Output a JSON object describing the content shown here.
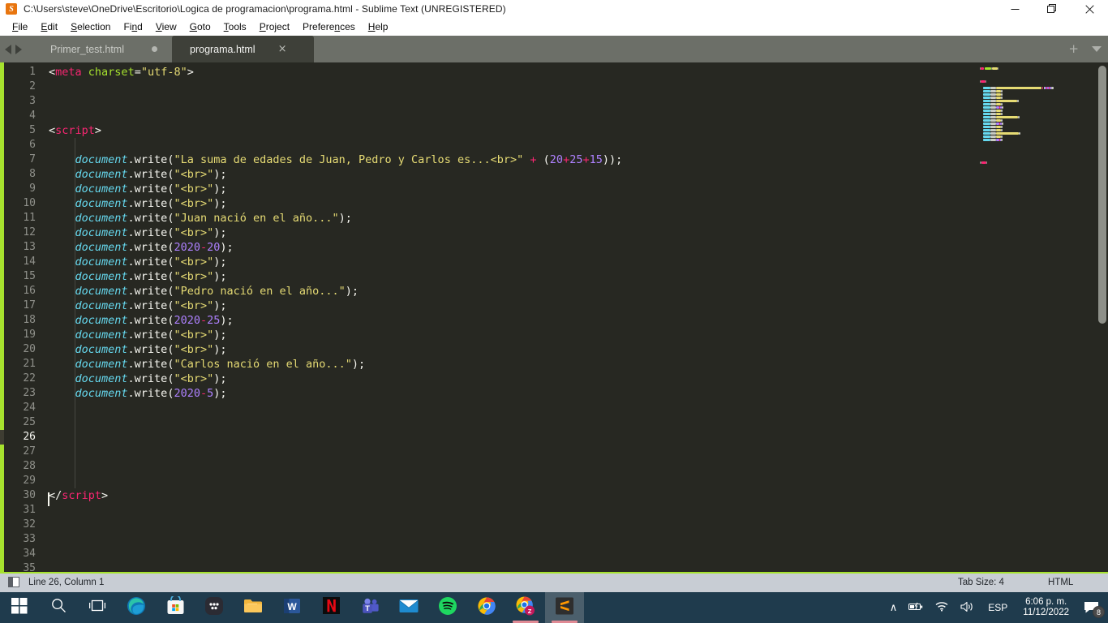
{
  "window": {
    "title": "C:\\Users\\steve\\OneDrive\\Escritorio\\Logica de programacion\\programa.html - Sublime Text (UNREGISTERED)",
    "logo_glyph": "S",
    "controls": {
      "minimize": "—",
      "restore": "❐",
      "close": "✕"
    },
    "accent_color": "#a6e22e",
    "background_color": "#272822"
  },
  "menubar": {
    "items": [
      {
        "label": "File",
        "mnemonic": "F"
      },
      {
        "label": "Edit",
        "mnemonic": "E"
      },
      {
        "label": "Selection",
        "mnemonic": "S"
      },
      {
        "label": "Find",
        "mnemonic": "n"
      },
      {
        "label": "View",
        "mnemonic": "V"
      },
      {
        "label": "Goto",
        "mnemonic": "G"
      },
      {
        "label": "Tools",
        "mnemonic": "T"
      },
      {
        "label": "Project",
        "mnemonic": "P"
      },
      {
        "label": "Preferences",
        "mnemonic": "n"
      },
      {
        "label": "Help",
        "mnemonic": "H"
      }
    ]
  },
  "tabs": {
    "items": [
      {
        "label": "Primer_test.html",
        "active": false,
        "dirty": true
      },
      {
        "label": "programa.html",
        "active": true,
        "dirty": false
      }
    ],
    "close_glyph": "×",
    "new_tab_glyph": "+"
  },
  "editor": {
    "first_line": 1,
    "last_line": 35,
    "cursor_line": 26,
    "lines": [
      {
        "n": 1,
        "tokens": [
          {
            "t": "punc",
            "v": "<"
          },
          {
            "t": "tag",
            "v": "meta"
          },
          {
            "t": "plain",
            "v": " "
          },
          {
            "t": "attr",
            "v": "charset"
          },
          {
            "t": "punc",
            "v": "="
          },
          {
            "t": "str",
            "v": "\"utf-8\""
          },
          {
            "t": "punc",
            "v": ">"
          }
        ]
      },
      {
        "n": 2,
        "tokens": []
      },
      {
        "n": 3,
        "tokens": []
      },
      {
        "n": 4,
        "tokens": []
      },
      {
        "n": 5,
        "tokens": [
          {
            "t": "punc",
            "v": "<"
          },
          {
            "t": "tag",
            "v": "script"
          },
          {
            "t": "punc",
            "v": ">"
          }
        ]
      },
      {
        "n": 6,
        "tokens": []
      },
      {
        "n": 7,
        "tokens": [
          {
            "t": "plain",
            "v": "    "
          },
          {
            "t": "var",
            "v": "document"
          },
          {
            "t": "fn",
            "v": ".write("
          },
          {
            "t": "str",
            "v": "\"La suma de edades de Juan, Pedro y Carlos es...<br>\""
          },
          {
            "t": "plain",
            "v": " "
          },
          {
            "t": "op",
            "v": "+"
          },
          {
            "t": "plain",
            "v": " "
          },
          {
            "t": "fn",
            "v": "("
          },
          {
            "t": "num",
            "v": "20"
          },
          {
            "t": "op",
            "v": "+"
          },
          {
            "t": "num",
            "v": "25"
          },
          {
            "t": "op",
            "v": "+"
          },
          {
            "t": "num",
            "v": "15"
          },
          {
            "t": "fn",
            "v": "));"
          }
        ]
      },
      {
        "n": 8,
        "tokens": [
          {
            "t": "plain",
            "v": "    "
          },
          {
            "t": "var",
            "v": "document"
          },
          {
            "t": "fn",
            "v": ".write("
          },
          {
            "t": "str",
            "v": "\"<br>\""
          },
          {
            "t": "fn",
            "v": ");"
          }
        ]
      },
      {
        "n": 9,
        "tokens": [
          {
            "t": "plain",
            "v": "    "
          },
          {
            "t": "var",
            "v": "document"
          },
          {
            "t": "fn",
            "v": ".write("
          },
          {
            "t": "str",
            "v": "\"<br>\""
          },
          {
            "t": "fn",
            "v": ");"
          }
        ]
      },
      {
        "n": 10,
        "tokens": [
          {
            "t": "plain",
            "v": "    "
          },
          {
            "t": "var",
            "v": "document"
          },
          {
            "t": "fn",
            "v": ".write("
          },
          {
            "t": "str",
            "v": "\"<br>\""
          },
          {
            "t": "fn",
            "v": ");"
          }
        ]
      },
      {
        "n": 11,
        "tokens": [
          {
            "t": "plain",
            "v": "    "
          },
          {
            "t": "var",
            "v": "document"
          },
          {
            "t": "fn",
            "v": ".write("
          },
          {
            "t": "str",
            "v": "\"Juan nació en el año...\""
          },
          {
            "t": "fn",
            "v": ");"
          }
        ]
      },
      {
        "n": 12,
        "tokens": [
          {
            "t": "plain",
            "v": "    "
          },
          {
            "t": "var",
            "v": "document"
          },
          {
            "t": "fn",
            "v": ".write("
          },
          {
            "t": "str",
            "v": "\"<br>\""
          },
          {
            "t": "fn",
            "v": ");"
          }
        ]
      },
      {
        "n": 13,
        "tokens": [
          {
            "t": "plain",
            "v": "    "
          },
          {
            "t": "var",
            "v": "document"
          },
          {
            "t": "fn",
            "v": ".write("
          },
          {
            "t": "num",
            "v": "2020"
          },
          {
            "t": "op",
            "v": "-"
          },
          {
            "t": "num",
            "v": "20"
          },
          {
            "t": "fn",
            "v": ");"
          }
        ]
      },
      {
        "n": 14,
        "tokens": [
          {
            "t": "plain",
            "v": "    "
          },
          {
            "t": "var",
            "v": "document"
          },
          {
            "t": "fn",
            "v": ".write("
          },
          {
            "t": "str",
            "v": "\"<br>\""
          },
          {
            "t": "fn",
            "v": ");"
          }
        ]
      },
      {
        "n": 15,
        "tokens": [
          {
            "t": "plain",
            "v": "    "
          },
          {
            "t": "var",
            "v": "document"
          },
          {
            "t": "fn",
            "v": ".write("
          },
          {
            "t": "str",
            "v": "\"<br>\""
          },
          {
            "t": "fn",
            "v": ");"
          }
        ]
      },
      {
        "n": 16,
        "tokens": [
          {
            "t": "plain",
            "v": "    "
          },
          {
            "t": "var",
            "v": "document"
          },
          {
            "t": "fn",
            "v": ".write("
          },
          {
            "t": "str",
            "v": "\"Pedro nació en el año...\""
          },
          {
            "t": "fn",
            "v": ");"
          }
        ]
      },
      {
        "n": 17,
        "tokens": [
          {
            "t": "plain",
            "v": "    "
          },
          {
            "t": "var",
            "v": "document"
          },
          {
            "t": "fn",
            "v": ".write("
          },
          {
            "t": "str",
            "v": "\"<br>\""
          },
          {
            "t": "fn",
            "v": ");"
          }
        ]
      },
      {
        "n": 18,
        "tokens": [
          {
            "t": "plain",
            "v": "    "
          },
          {
            "t": "var",
            "v": "document"
          },
          {
            "t": "fn",
            "v": ".write("
          },
          {
            "t": "num",
            "v": "2020"
          },
          {
            "t": "op",
            "v": "-"
          },
          {
            "t": "num",
            "v": "25"
          },
          {
            "t": "fn",
            "v": ");"
          }
        ]
      },
      {
        "n": 19,
        "tokens": [
          {
            "t": "plain",
            "v": "    "
          },
          {
            "t": "var",
            "v": "document"
          },
          {
            "t": "fn",
            "v": ".write("
          },
          {
            "t": "str",
            "v": "\"<br>\""
          },
          {
            "t": "fn",
            "v": ");"
          }
        ]
      },
      {
        "n": 20,
        "tokens": [
          {
            "t": "plain",
            "v": "    "
          },
          {
            "t": "var",
            "v": "document"
          },
          {
            "t": "fn",
            "v": ".write("
          },
          {
            "t": "str",
            "v": "\"<br>\""
          },
          {
            "t": "fn",
            "v": ");"
          }
        ]
      },
      {
        "n": 21,
        "tokens": [
          {
            "t": "plain",
            "v": "    "
          },
          {
            "t": "var",
            "v": "document"
          },
          {
            "t": "fn",
            "v": ".write("
          },
          {
            "t": "str",
            "v": "\"Carlos nació en el año...\""
          },
          {
            "t": "fn",
            "v": ");"
          }
        ]
      },
      {
        "n": 22,
        "tokens": [
          {
            "t": "plain",
            "v": "    "
          },
          {
            "t": "var",
            "v": "document"
          },
          {
            "t": "fn",
            "v": ".write("
          },
          {
            "t": "str",
            "v": "\"<br>\""
          },
          {
            "t": "fn",
            "v": ");"
          }
        ]
      },
      {
        "n": 23,
        "tokens": [
          {
            "t": "plain",
            "v": "    "
          },
          {
            "t": "var",
            "v": "document"
          },
          {
            "t": "fn",
            "v": ".write("
          },
          {
            "t": "num",
            "v": "2020"
          },
          {
            "t": "op",
            "v": "-"
          },
          {
            "t": "num",
            "v": "5"
          },
          {
            "t": "fn",
            "v": ");"
          }
        ]
      },
      {
        "n": 24,
        "tokens": []
      },
      {
        "n": 25,
        "tokens": []
      },
      {
        "n": 26,
        "tokens": []
      },
      {
        "n": 27,
        "tokens": []
      },
      {
        "n": 28,
        "tokens": []
      },
      {
        "n": 29,
        "tokens": []
      },
      {
        "n": 30,
        "tokens": [
          {
            "t": "punc",
            "v": "</"
          },
          {
            "t": "tag",
            "v": "script"
          },
          {
            "t": "punc",
            "v": ">"
          }
        ]
      },
      {
        "n": 31,
        "tokens": []
      },
      {
        "n": 32,
        "tokens": []
      },
      {
        "n": 33,
        "tokens": []
      },
      {
        "n": 34,
        "tokens": []
      },
      {
        "n": 35,
        "tokens": []
      }
    ]
  },
  "statusbar": {
    "position": "Line 26, Column 1",
    "tab_size": "Tab Size: 4",
    "syntax": "HTML"
  },
  "taskbar": {
    "items": [
      {
        "name": "start",
        "running": false,
        "active": false
      },
      {
        "name": "search",
        "running": false,
        "active": false
      },
      {
        "name": "task-view",
        "running": false,
        "active": false
      },
      {
        "name": "edge",
        "running": false,
        "active": false
      },
      {
        "name": "microsoft-store",
        "running": false,
        "active": false
      },
      {
        "name": "todoist",
        "running": false,
        "active": false
      },
      {
        "name": "file-explorer",
        "running": false,
        "active": false
      },
      {
        "name": "word",
        "running": false,
        "active": false
      },
      {
        "name": "netflix",
        "running": false,
        "active": false
      },
      {
        "name": "teams",
        "running": false,
        "active": false
      },
      {
        "name": "mail",
        "running": false,
        "active": false
      },
      {
        "name": "spotify",
        "running": false,
        "active": false
      },
      {
        "name": "chrome",
        "running": false,
        "active": false
      },
      {
        "name": "chrome-zoom",
        "running": true,
        "active": false
      },
      {
        "name": "sublime-text",
        "running": true,
        "active": true
      }
    ],
    "tray": {
      "overflow_glyph": "∧",
      "language": "ESP",
      "time": "6:06 p. m.",
      "date": "11/12/2022",
      "notification_count": "8"
    }
  }
}
